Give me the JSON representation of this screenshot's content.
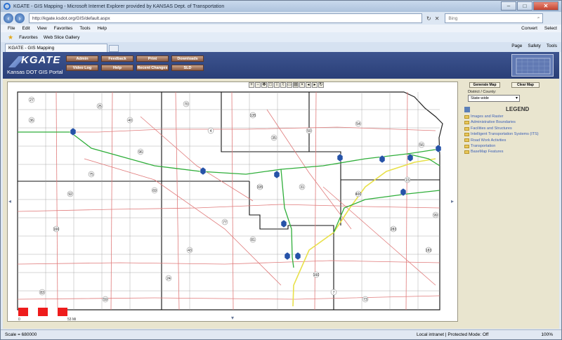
{
  "browser": {
    "title": "KGATE - GIS Mapping - Microsoft Internet Explorer provided by KANSAS Dept. of Transportation",
    "address": "http://kgate.ksdot.org/GIS/default.aspx",
    "search_engine": "Bing",
    "menu": [
      "File",
      "Edit",
      "View",
      "Favorites",
      "Tools",
      "Help"
    ],
    "menu_right": [
      "Convert",
      "Select"
    ],
    "favorites_label": "Favorites",
    "web_slice_label": "Web Slice Gallery",
    "tab_label": "KGATE - GIS Mapping",
    "command_bar": [
      "Page",
      "Safety",
      "Tools"
    ]
  },
  "portal": {
    "logo": "KGATE",
    "subtitle": "Kansas DOT GIS Portal",
    "buttons_row1": [
      "Admin",
      "Feedback",
      "Print",
      "Downloads"
    ],
    "buttons_row2": [
      "Video Log",
      "Help",
      "Recent Changes",
      "SLD"
    ]
  },
  "panel": {
    "generate_map": "Generate Map",
    "clear_map": "Clear Map",
    "district_label": "District / County:",
    "district_value": "State-wide",
    "legend_title": "LEGEND",
    "legend_items": [
      "Images and Raster",
      "Administrative Boundaries",
      "Facilities and Structures",
      "Intelligent Transportation Systems (ITS)",
      "Road Work Activities",
      "Transportation",
      "BaseMap Features"
    ]
  },
  "map": {
    "scale_start": "0",
    "scale_end": "53 Mi",
    "route_labels": [
      "27",
      "36",
      "83",
      "25",
      "40",
      "70",
      "135",
      "35",
      "50",
      "54",
      "56",
      "75",
      "69",
      "77",
      "81",
      "160",
      "400",
      "283",
      "183",
      "24",
      "59",
      "166",
      "335",
      "7",
      "73",
      "4",
      "96",
      "15",
      "92",
      "31",
      "43",
      "99"
    ]
  },
  "status": {
    "scale": "Scale = 680000",
    "zone": "Local intranet | Protected Mode: Off",
    "zoom": "100%"
  },
  "colors": {
    "banner": "#2f4582",
    "panel": "#e9e5cf",
    "interstate": "#2fae3a",
    "turnpike": "#e8e04a",
    "highway": "#e07a7a"
  }
}
